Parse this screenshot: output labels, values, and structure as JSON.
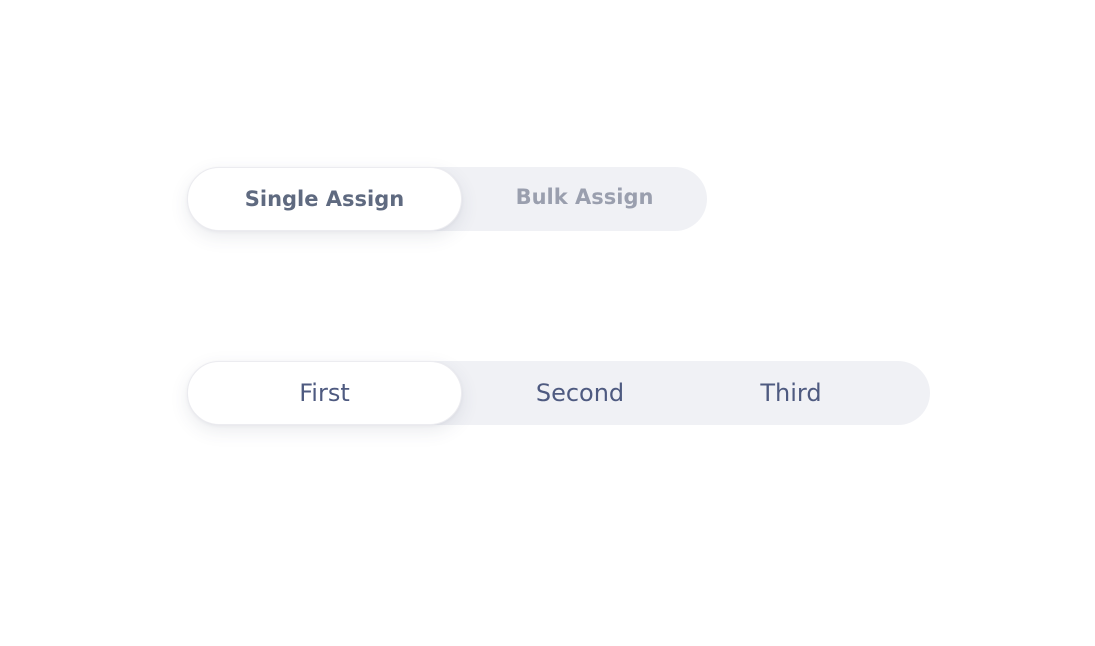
{
  "assign_toggle": {
    "items": [
      {
        "label": "Single Assign",
        "selected": true
      },
      {
        "label": "Bulk Assign",
        "selected": false
      }
    ]
  },
  "numbered_toggle": {
    "items": [
      {
        "label": "First",
        "selected": true
      },
      {
        "label": "Second",
        "selected": false
      },
      {
        "label": "Third",
        "selected": false
      }
    ]
  },
  "colors": {
    "track": "#f0f1f5",
    "active_bg": "#ffffff",
    "active_text": "#5f6a80",
    "inactive_text": "#9a9fae",
    "numbered_text": "#4e5a80"
  }
}
